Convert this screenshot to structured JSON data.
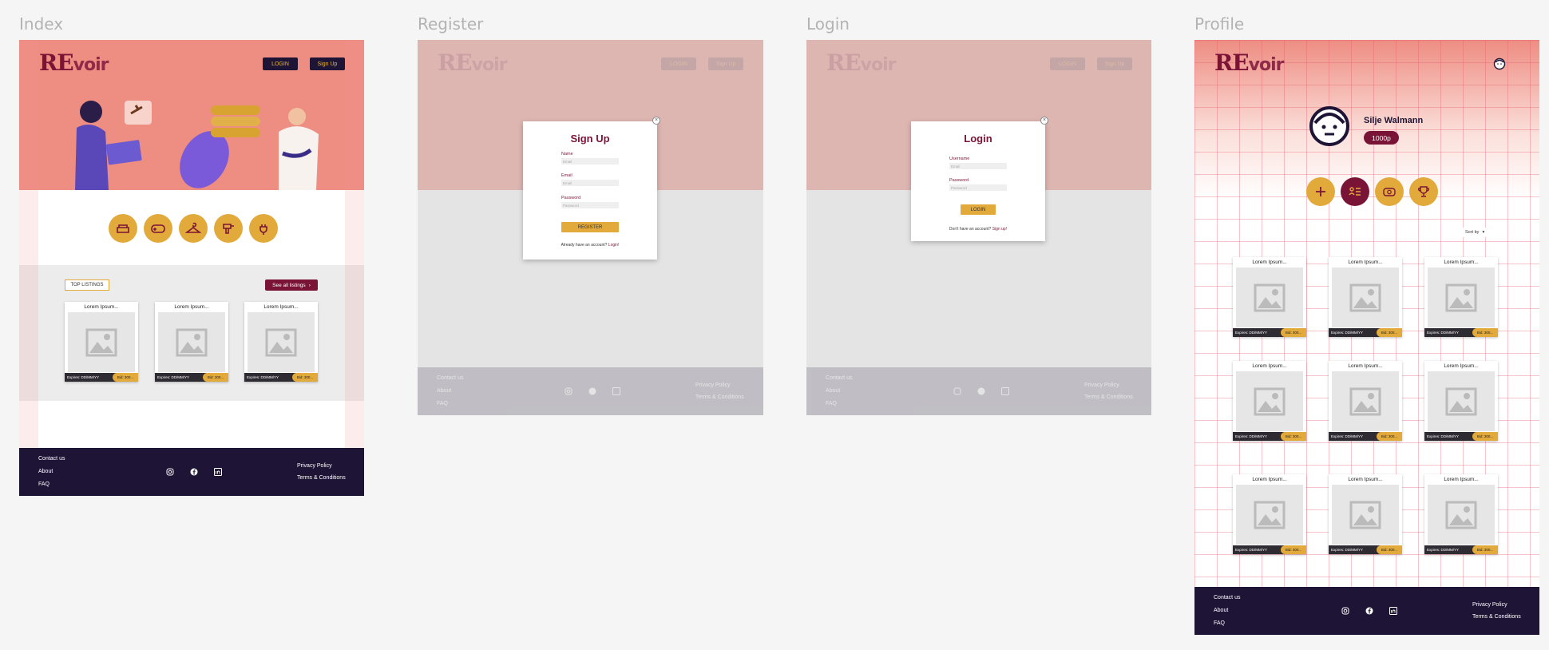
{
  "frames": {
    "index": "Index",
    "register": "Register",
    "login": "Login",
    "profile": "Profile"
  },
  "brand": {
    "logo_big": "RE",
    "logo_small": "voir"
  },
  "nav": {
    "login": "LOGIN",
    "signup": "Sign Up"
  },
  "categories": [
    "sofa-icon",
    "gamepad-icon",
    "hanger-icon",
    "drill-icon",
    "plug-icon"
  ],
  "listings": {
    "top_label": "TOP LISTINGS",
    "see_all": "See all listings"
  },
  "card": {
    "title": "Lorem Ipsum...",
    "expires": "Expires: DD/MM/YY",
    "bid": "Bid: 300..."
  },
  "footer": {
    "contact": "Contact us",
    "about": "About",
    "faq": "FAQ",
    "privacy": "Privacy Policy",
    "terms": "Terms & Conditions",
    "social": [
      "instagram-icon",
      "facebook-icon",
      "linkedin-icon"
    ]
  },
  "register": {
    "title": "Sign Up",
    "name_label": "Name",
    "name_placeholder": "Email",
    "email_label": "Email",
    "email_placeholder": "Email",
    "password_label": "Password",
    "password_placeholder": "Password",
    "button": "REGISTER",
    "note": "Already have an account?",
    "note_link": "Login!"
  },
  "login": {
    "title": "Login",
    "username_label": "Username",
    "username_placeholder": "Email",
    "password_label": "Password",
    "password_placeholder": "Password",
    "button": "LOGIN",
    "note": "Don't have an account?",
    "note_link": "Sign up!"
  },
  "profile": {
    "name": "Silje Walmann",
    "points": "1000p",
    "sort_label": "Sort by"
  },
  "colors": {
    "accent": "#e2a93b",
    "brand": "#7a1436",
    "dark": "#1e1436",
    "hero": "#ee8d82"
  }
}
